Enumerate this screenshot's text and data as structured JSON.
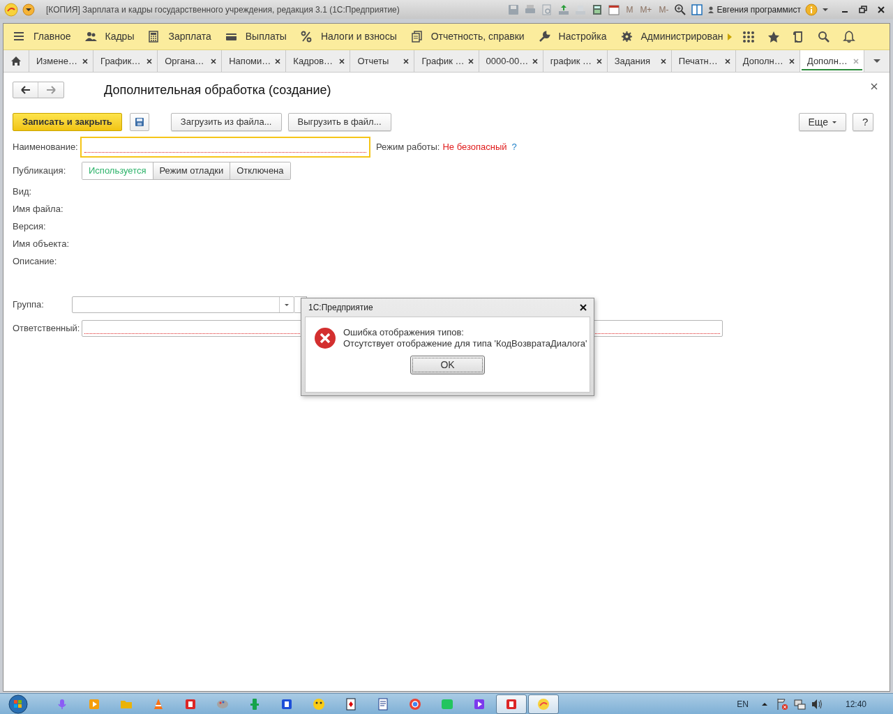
{
  "window": {
    "title": "[КОПИЯ] Зарплата и кадры государственного учреждения, редакция 3.1  (1С:Предприятие)",
    "memory_buttons": [
      "M",
      "M+",
      "M-"
    ],
    "user": "Евгения программист"
  },
  "menu": [
    {
      "label": "Главное",
      "kind": "menu"
    },
    {
      "label": "Кадры",
      "kind": "people"
    },
    {
      "label": "Зарплата",
      "kind": "calculator"
    },
    {
      "label": "Выплаты",
      "kind": "wallet"
    },
    {
      "label": "Налоги и взносы",
      "kind": "percent"
    },
    {
      "label": "Отчетность, справки",
      "kind": "documents"
    },
    {
      "label": "Настройка",
      "kind": "wrench"
    },
    {
      "label": "Администрирован",
      "kind": "gear"
    }
  ],
  "tabs": [
    {
      "label": "Измене…",
      "selected": false
    },
    {
      "label": "График…",
      "selected": false
    },
    {
      "label": "Органа…",
      "selected": false
    },
    {
      "label": "Напоми…",
      "selected": false
    },
    {
      "label": "Кадров…",
      "selected": false
    },
    {
      "label": "Отчеты",
      "selected": false
    },
    {
      "label": "График …",
      "selected": false
    },
    {
      "label": "0000-00…",
      "selected": false
    },
    {
      "label": "график …",
      "selected": false
    },
    {
      "label": "Задания",
      "selected": false
    },
    {
      "label": "Печатн…",
      "selected": false
    },
    {
      "label": "Дополн…",
      "selected": false
    },
    {
      "label": "Дополн…",
      "selected": true
    }
  ],
  "form": {
    "title": "Дополнительная обработка (создание)",
    "buttons": {
      "save_close": "Записать и закрыть",
      "load": "Загрузить из файла...",
      "unload": "Выгрузить в файл...",
      "more": "Еще",
      "help": "?"
    },
    "name_label": "Наименование:",
    "mode_label": "Режим работы:",
    "mode_value": "Не безопасный",
    "mode_help": "?",
    "publication_label": "Публикация:",
    "publication_options": [
      {
        "label": "Используется",
        "selected": true
      },
      {
        "label": "Режим отладки",
        "selected": false
      },
      {
        "label": "Отключена",
        "selected": false
      }
    ],
    "info_labels": [
      "Вид:",
      "Имя файла:",
      "Версия:",
      "Имя объекта:",
      "Описание:"
    ],
    "group_label": "Группа:",
    "responsible_label": "Ответственный:"
  },
  "dialog": {
    "title": "1С:Предприятие",
    "message": [
      "Ошибка отображения типов:",
      "Отсутствует отображение для типа 'КодВозвратаДиалога'"
    ],
    "button": "OK"
  },
  "taskbar": {
    "apps": [
      {
        "kind": "mic",
        "selected": false
      },
      {
        "kind": "play",
        "selected": false
      },
      {
        "kind": "folder",
        "selected": false
      },
      {
        "kind": "cone",
        "selected": false
      },
      {
        "kind": "letter",
        "selected": false
      },
      {
        "kind": "palette",
        "selected": false
      },
      {
        "kind": "tool",
        "selected": false
      },
      {
        "kind": "letter",
        "selected": false
      },
      {
        "kind": "face",
        "selected": false
      },
      {
        "kind": "card",
        "selected": false
      },
      {
        "kind": "doc",
        "selected": false
      },
      {
        "kind": "circle",
        "selected": false
      },
      {
        "kind": "square",
        "selected": false
      },
      {
        "kind": "play",
        "selected": false
      },
      {
        "kind": "letter",
        "selected": true
      },
      {
        "kind": "logo",
        "selected": true
      }
    ],
    "language": "EN",
    "time": "12:40"
  }
}
